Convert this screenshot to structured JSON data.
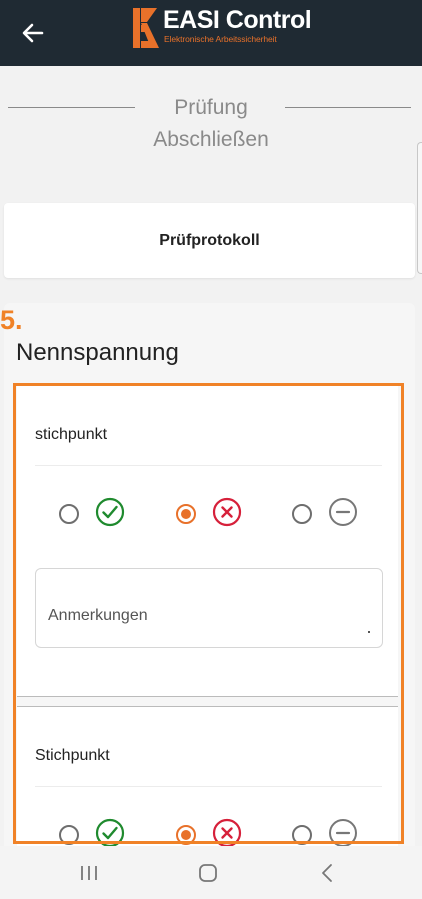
{
  "header": {
    "back_icon": "arrow-left-icon",
    "logo_title": "EASI Control",
    "logo_subtitle": "Elektronische Arbeitssicherheit",
    "background_color": "#1f2a33",
    "accent_color": "#e8712a"
  },
  "step": {
    "title_line1": "Prüfung",
    "title_line2": "Abschließen"
  },
  "protocol_card": {
    "label": "Prüfprotokoll"
  },
  "section": {
    "number": "5.",
    "title": "Nennspannung",
    "highlight_color": "#f08227"
  },
  "items": [
    {
      "label": "stichpunkt",
      "options": [
        {
          "icon": "check-circle-icon",
          "color": "#1f8a2e",
          "selected": false
        },
        {
          "icon": "x-circle-icon",
          "color": "#d6203a",
          "selected": true
        },
        {
          "icon": "minus-circle-icon",
          "color": "#777777",
          "selected": false
        }
      ],
      "notes_placeholder": "Anmerkungen",
      "notes_value": ""
    },
    {
      "label": "Stichpunkt",
      "options": [
        {
          "icon": "check-circle-icon",
          "color": "#1f8a2e",
          "selected": false
        },
        {
          "icon": "x-circle-icon",
          "color": "#d6203a",
          "selected": true
        },
        {
          "icon": "minus-circle-icon",
          "color": "#777777",
          "selected": false
        }
      ]
    }
  ],
  "system_nav": {
    "icons": [
      "recent-apps-icon",
      "home-icon",
      "back-icon"
    ]
  }
}
